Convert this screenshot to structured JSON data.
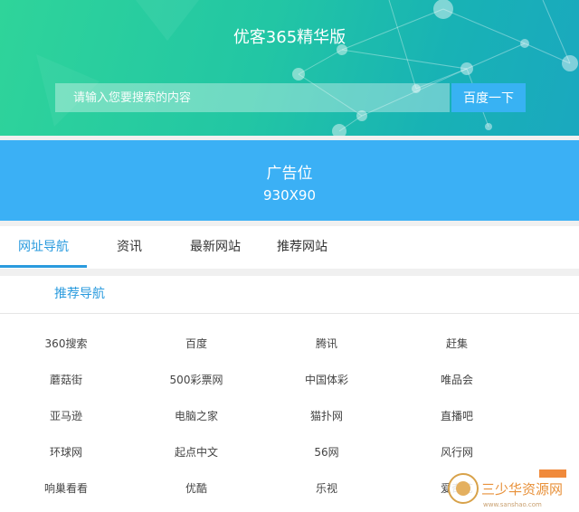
{
  "header": {
    "title": "优客365精华版",
    "search_placeholder": "请输入您要搜索的内容",
    "search_button": "百度一下"
  },
  "ad": {
    "line1": "广告位",
    "line2": "930X90"
  },
  "tabs": [
    {
      "label": "网址导航",
      "active": true
    },
    {
      "label": "资讯",
      "active": false
    },
    {
      "label": "最新网站",
      "active": false
    },
    {
      "label": "推荐网站",
      "active": false
    }
  ],
  "panel": {
    "title": "推荐导航",
    "links": [
      [
        "360搜索",
        "百度",
        "腾讯",
        "赶集"
      ],
      [
        "蘑菇街",
        "500彩票网",
        "中国体彩",
        "唯品会"
      ],
      [
        "亚马逊",
        "电脑之家",
        "猫扑网",
        "直播吧"
      ],
      [
        "环球网",
        "起点中文",
        "56网",
        "风行网"
      ],
      [
        "响巢看看",
        "优酷",
        "乐视",
        "爱奇艺"
      ]
    ]
  },
  "watermark": {
    "text": "三少华资源网",
    "sub": "www.sanshao.com"
  },
  "colors": {
    "accent": "#2a9bde",
    "ad_background": "#3bb0f5",
    "hero_start": "#2fd49a",
    "hero_end": "#1aa8bf"
  }
}
